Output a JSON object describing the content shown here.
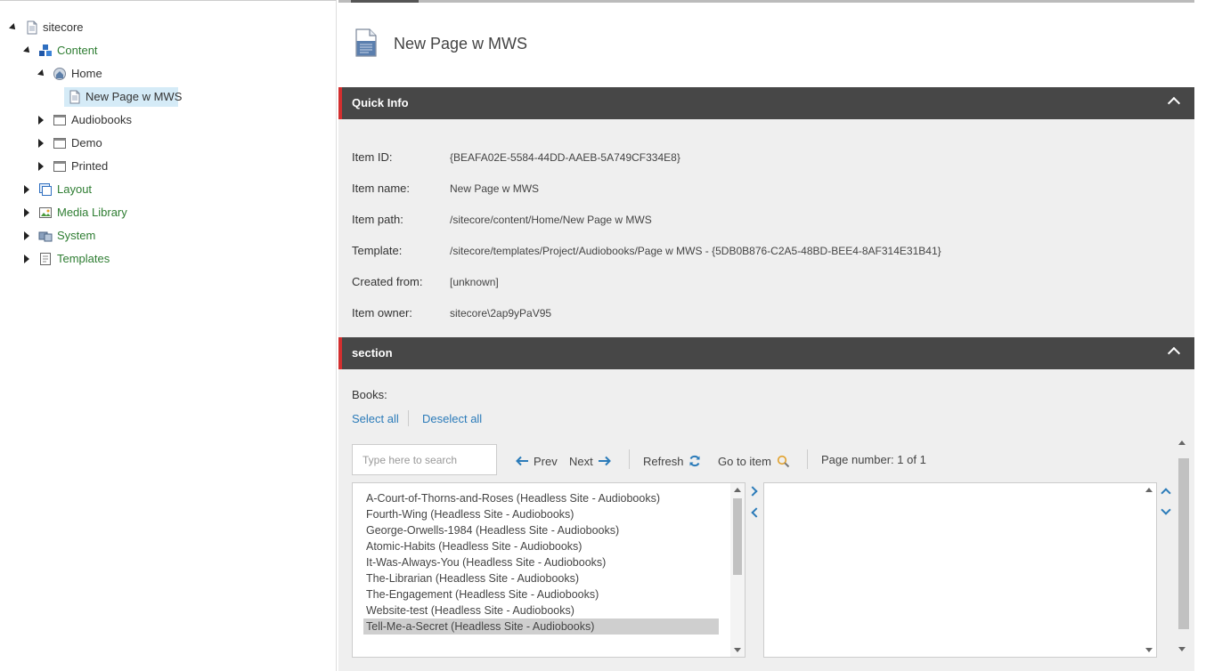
{
  "tree": {
    "items": [
      {
        "label": "sitecore",
        "icon": "page-icon",
        "state": "expanded"
      },
      {
        "label": "Content",
        "icon": "content-cubes-icon",
        "state": "expanded"
      },
      {
        "label": "Home",
        "icon": "home-icon",
        "state": "expanded"
      },
      {
        "label": "New Page w MWS",
        "icon": "page-icon",
        "state": "leaf",
        "selected": true
      },
      {
        "label": "Audiobooks",
        "icon": "window-icon",
        "state": "collapsed"
      },
      {
        "label": "Demo",
        "icon": "window-icon",
        "state": "collapsed"
      },
      {
        "label": "Printed",
        "icon": "window-icon",
        "state": "collapsed"
      },
      {
        "label": "Layout",
        "icon": "layout-icon",
        "state": "collapsed"
      },
      {
        "label": "Media Library",
        "icon": "image-icon",
        "state": "collapsed"
      },
      {
        "label": "System",
        "icon": "system-icon",
        "state": "collapsed"
      },
      {
        "label": "Templates",
        "icon": "template-icon",
        "state": "collapsed"
      }
    ]
  },
  "header": {
    "title": "New Page w MWS",
    "icon": "page-icon"
  },
  "quick_info": {
    "title": "Quick Info",
    "rows": [
      {
        "label": "Item ID:",
        "value": "{BEAFA02E-5584-44DD-AAEB-5A749CF334E8}"
      },
      {
        "label": "Item name:",
        "value": "New Page w MWS"
      },
      {
        "label": "Item path:",
        "value": "/sitecore/content/Home/New Page w MWS"
      },
      {
        "label": "Template:",
        "value": "/sitecore/templates/Project/Audiobooks/Page w MWS - {5DB0B876-C2A5-48BD-BEE4-8AF314E31B41}"
      },
      {
        "label": "Created from:",
        "value": "[unknown]"
      },
      {
        "label": "Item owner:",
        "value": "sitecore\\2ap9yPaV95"
      }
    ]
  },
  "section": {
    "title": "section",
    "field_label": "Books:",
    "select_all": "Select all",
    "deselect_all": "Deselect all",
    "search_placeholder": "Type here to search",
    "prev": "Prev",
    "next": "Next",
    "refresh": "Refresh",
    "go_to_item": "Go to item",
    "page_number": "Page number: 1 of 1",
    "available": [
      "A-Court-of-Thorns-and-Roses (Headless Site - Audiobooks)",
      "Fourth-Wing (Headless Site - Audiobooks)",
      "George-Orwells-1984 (Headless Site - Audiobooks)",
      "Atomic-Habits (Headless Site - Audiobooks)",
      "It-Was-Always-You (Headless Site - Audiobooks)",
      "The-Librarian (Headless Site - Audiobooks)",
      "The-Engagement (Headless Site - Audiobooks)",
      "Website-test (Headless Site - Audiobooks)",
      "Tell-Me-a-Secret (Headless Site - Audiobooks)"
    ],
    "selected_available_index": 8,
    "selected": []
  },
  "colors": {
    "accent_red": "#d32f2f",
    "section_bar": "#474747",
    "link_blue": "#2b7bb9",
    "tree_green": "#2e7d32",
    "tree_selection": "#d5ebf7"
  }
}
